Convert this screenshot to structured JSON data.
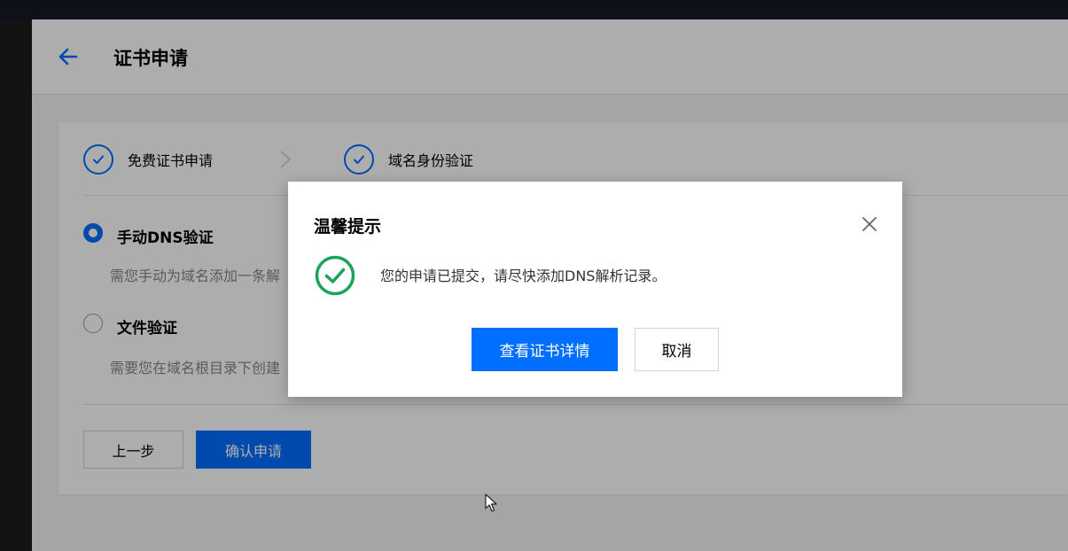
{
  "header": {
    "title": "证书申请"
  },
  "steps": [
    {
      "label": "免费证书申请",
      "status": "done"
    },
    {
      "label": "域名身份验证",
      "status": "done"
    }
  ],
  "options": [
    {
      "label": "手动DNS验证",
      "description": "需您手动为域名添加一条解",
      "checked": true
    },
    {
      "label": "文件验证",
      "description": "需要您在域名根目录下创建",
      "checked": false
    }
  ],
  "actions": {
    "prev_label": "上一步",
    "confirm_label": "确认申请"
  },
  "dialog": {
    "title": "温馨提示",
    "message": "您的申请已提交，请尽快添加DNS解析记录。",
    "primary_label": "查看证书详情",
    "cancel_label": "取消"
  },
  "colors": {
    "accent": "#006eff",
    "success": "#1aa35a"
  },
  "icons": [
    "back-arrow-icon",
    "check-icon",
    "chevron-right-icon",
    "close-icon",
    "success-check-circle-icon",
    "mouse-cursor-icon"
  ]
}
